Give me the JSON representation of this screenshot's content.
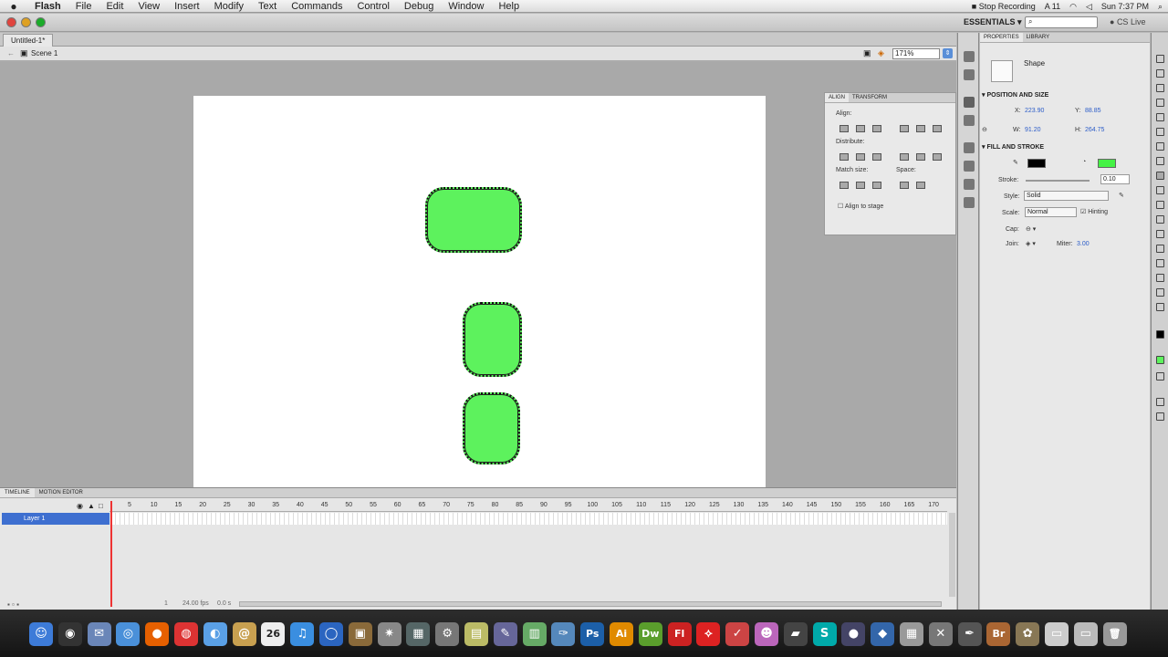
{
  "menubar": {
    "app_name": "Flash",
    "items": [
      "File",
      "Edit",
      "View",
      "Insert",
      "Modify",
      "Text",
      "Commands",
      "Control",
      "Debug",
      "Window",
      "Help"
    ],
    "stop_recording": "Stop Recording",
    "status_number": "11",
    "clock": "Sun 7:37 PM"
  },
  "appbar": {
    "workspace": "ESSENTIALS ▾",
    "cs_live": "CS Live"
  },
  "document": {
    "tab_title": "Untitled-1*",
    "scene": "Scene 1",
    "zoom": "171%"
  },
  "align_panel": {
    "tabs": [
      "ALIGN",
      "TRANSFORM"
    ],
    "align_label": "Align:",
    "distribute_label": "Distribute:",
    "match_size_label": "Match size:",
    "space_label": "Space:",
    "align_to_stage": "Align to stage"
  },
  "properties": {
    "tabs": [
      "PROPERTIES",
      "LIBRARY"
    ],
    "object_type": "Shape",
    "position_section": "POSITION AND SIZE",
    "x_label": "X:",
    "x_value": "223.90",
    "y_label": "Y:",
    "y_value": "88.85",
    "w_label": "W:",
    "w_value": "91.20",
    "h_label": "H:",
    "h_value": "264.75",
    "fill_section": "FILL AND STROKE",
    "stroke_color": "#000000",
    "fill_color": "#45f245",
    "stroke_label": "Stroke:",
    "stroke_value": "0.10",
    "style_label": "Style:",
    "style_value": "Solid",
    "scale_label": "Scale:",
    "scale_value": "Normal",
    "hinting": "Hinting",
    "cap_label": "Cap:",
    "join_label": "Join:",
    "miter_label": "Miter:",
    "miter_value": "3.00"
  },
  "timeline": {
    "tabs": [
      "TIMELINE",
      "MOTION EDITOR"
    ],
    "layer_name": "Layer 1",
    "frame_numbers": [
      "5",
      "10",
      "15",
      "20",
      "25",
      "30",
      "35",
      "40",
      "45",
      "50",
      "55",
      "60",
      "65",
      "70",
      "75",
      "80",
      "85",
      "90",
      "95",
      "100",
      "105",
      "110",
      "115",
      "120",
      "125",
      "130",
      "135",
      "140",
      "145",
      "150",
      "155",
      "160",
      "165",
      "170"
    ],
    "fps": "24.00 fps",
    "time": "0.0 s",
    "current_frame": "1"
  },
  "shapes": {
    "fill_color": "#5df25d"
  },
  "dock": {
    "calendar_day": "26",
    "apps": [
      {
        "icon": "finder-icon",
        "color": "#3d7bd8",
        "glyph": "☺"
      },
      {
        "icon": "dashboard-icon",
        "color": "#333",
        "glyph": "◉"
      },
      {
        "icon": "mail-icon",
        "color": "#6a86b8",
        "glyph": "✉"
      },
      {
        "icon": "safari-icon",
        "color": "#4a90d9",
        "glyph": "◎"
      },
      {
        "icon": "firefox-icon",
        "color": "#e66000",
        "glyph": "●"
      },
      {
        "icon": "chrome-icon",
        "color": "#d33",
        "glyph": "◍"
      },
      {
        "icon": "ichat-icon",
        "color": "#5aa0e6",
        "glyph": "◐"
      },
      {
        "icon": "address-book-icon",
        "color": "#c8a050",
        "glyph": "@"
      },
      {
        "icon": "ical-icon",
        "color": "#eee",
        "glyph": ""
      },
      {
        "icon": "itunes-icon",
        "color": "#3a8ee0",
        "glyph": "♫"
      },
      {
        "icon": "network-icon",
        "color": "#2b65c0",
        "glyph": "◯"
      },
      {
        "icon": "preview-icon",
        "color": "#8a6a3a",
        "glyph": "▣"
      },
      {
        "icon": "tools-icon",
        "color": "#888",
        "glyph": "✷"
      },
      {
        "icon": "window-icon",
        "color": "#566",
        "glyph": "▦"
      },
      {
        "icon": "utility-icon",
        "color": "#777",
        "glyph": "⚙"
      },
      {
        "icon": "keynote-icon",
        "color": "#bb6",
        "glyph": "▤"
      },
      {
        "icon": "graphics-icon",
        "color": "#669",
        "glyph": "✎"
      },
      {
        "icon": "chart-app-icon",
        "color": "#6a6",
        "glyph": "▥"
      },
      {
        "icon": "pen-app-icon",
        "color": "#58b",
        "glyph": "✑"
      },
      {
        "icon": "photoshop-icon",
        "color": "#1c5fa8",
        "glyph": "Ps"
      },
      {
        "icon": "illustrator-icon",
        "color": "#e08a00",
        "glyph": "Ai"
      },
      {
        "icon": "dreamweaver-icon",
        "color": "#5a9e2c",
        "glyph": "Dw"
      },
      {
        "icon": "flash-icon",
        "color": "#c22",
        "glyph": "Fl"
      },
      {
        "icon": "acrobat-icon",
        "color": "#d22",
        "glyph": "⟡"
      },
      {
        "icon": "pdf-icon",
        "color": "#c44",
        "glyph": "✓"
      },
      {
        "icon": "mascot-icon",
        "color": "#b6b",
        "glyph": "☻"
      },
      {
        "icon": "clapper-icon",
        "color": "#444",
        "glyph": "▰"
      },
      {
        "icon": "skype-icon",
        "color": "#0aa",
        "glyph": "S"
      },
      {
        "icon": "sphere-icon",
        "color": "#446",
        "glyph": "●"
      },
      {
        "icon": "python-icon",
        "color": "#36a",
        "glyph": "◆"
      },
      {
        "icon": "calculator-icon",
        "color": "#999",
        "glyph": "▦"
      },
      {
        "icon": "x11-icon",
        "color": "#777",
        "glyph": "✕"
      },
      {
        "icon": "pen-icon",
        "color": "#555",
        "glyph": "✒"
      },
      {
        "icon": "bridge-icon",
        "color": "#a63",
        "glyph": "Br"
      },
      {
        "icon": "photos-icon",
        "color": "#875",
        "glyph": "✿"
      },
      {
        "icon": "docs-icon",
        "color": "#ccc",
        "glyph": "▭"
      },
      {
        "icon": "downloads-icon",
        "color": "#bbb",
        "glyph": "▭"
      },
      {
        "icon": "trash-icon",
        "color": "#999",
        "glyph": "🗑"
      }
    ]
  }
}
